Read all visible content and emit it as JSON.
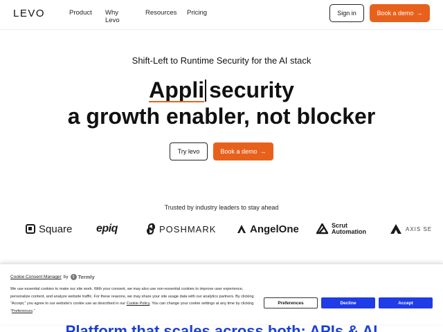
{
  "nav": {
    "logo": "LEVO",
    "links": [
      "Product",
      "Why Levo",
      "Resources",
      "Pricing"
    ],
    "signin_label": "Sign in",
    "demo_label": "Book a demo",
    "arrow": "→"
  },
  "hero": {
    "tagline": "Shift-Left to Runtime Security for the AI stack",
    "typed_word": "Appli",
    "line1_rest": "security",
    "line2": "a growth enabler, not blocker",
    "try_label": "Try levo",
    "demo_label": "Book a demo",
    "arrow": "→"
  },
  "trusted": {
    "text": "Trusted by industry leaders to stay ahead",
    "logos": {
      "square": "Square",
      "epiq": "epiq",
      "poshmark": "POSHMARK",
      "angelone": "AngelOne",
      "scrut_line1": "Scrut",
      "scrut_line2": "Automation",
      "axis": "AXIS SE"
    }
  },
  "cookie": {
    "title": "Cookie Consent Manager",
    "by": "by",
    "termly": "Termly",
    "text_part1": "We use essential cookies to make our site work. With your consent, we may also use non-essential cookies to improve user experience, personalize content, and analyze website traffic. For these reasons, we may share your site usage data with our analytics partners. By clicking “Accept,” you agree to our website's cookie use as described in our ",
    "policy_link": "Cookie Policy",
    "text_part2": ". You can change your cookie settings at any time by clicking “",
    "preferences_link": "Preferences",
    "text_part3": ".”",
    "preferences_button": "Preferences",
    "decline_button": "Decline",
    "accept_button": "Accept"
  },
  "section": {
    "heading": "Platform that scales across both: APIs & AI"
  },
  "colors": {
    "accent": "#e8611c",
    "cookie_button": "#1f3ce6"
  }
}
